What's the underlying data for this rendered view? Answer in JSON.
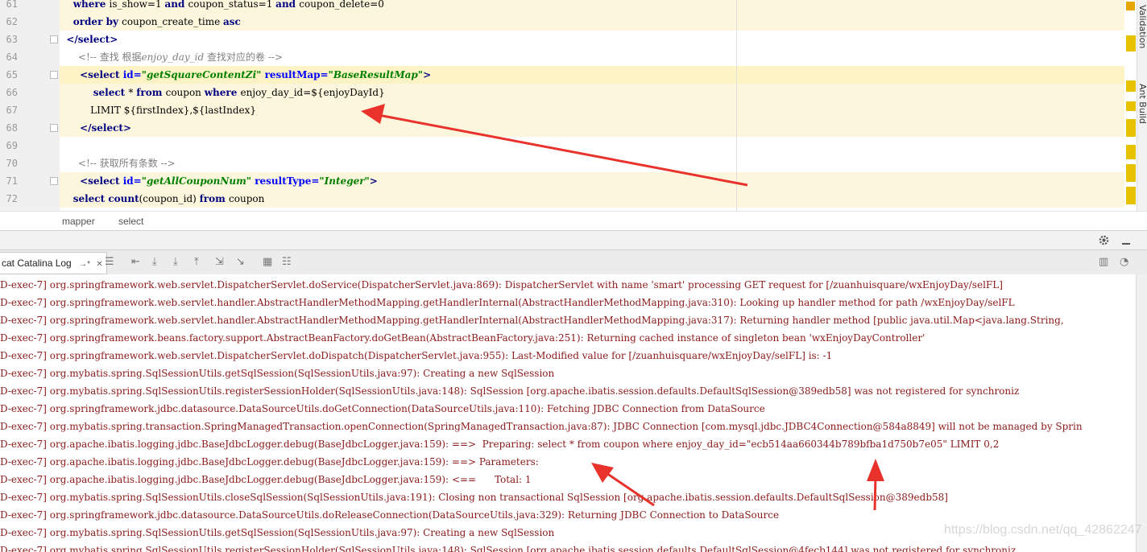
{
  "editor": {
    "lines": [
      {
        "num": "61",
        "parts": [
          [
            "kw",
            "    where "
          ],
          [
            "",
            "is_show=1 "
          ],
          [
            "kw",
            "and "
          ],
          [
            "",
            "coupon_status=1 "
          ],
          [
            "kw",
            "and "
          ],
          [
            "",
            "coupon_delete=0"
          ]
        ]
      },
      {
        "num": "62",
        "parts": [
          [
            "kw",
            "    order by "
          ],
          [
            "",
            "coupon_create_time "
          ],
          [
            "kw",
            "asc"
          ]
        ]
      },
      {
        "num": "63",
        "parts": [
          [
            "tag",
            "  </select>"
          ]
        ]
      },
      {
        "num": "64",
        "parts": [
          [
            "cm",
            "      <!-- 查找 根据"
          ],
          [
            "cmi",
            "enjoy_day_id"
          ],
          [
            "cm",
            " 查找对应的卷 -->"
          ]
        ]
      },
      {
        "num": "65",
        "parts": [
          [
            "tag",
            "      <select "
          ],
          [
            "attr",
            "id="
          ],
          [
            "str",
            "\"getSquareContentZi\" "
          ],
          [
            "attr",
            "resultMap="
          ],
          [
            "str",
            "\"BaseResultMap\""
          ],
          [
            "tag",
            ">"
          ]
        ]
      },
      {
        "num": "66",
        "parts": [
          [
            "kw",
            "          select "
          ],
          [
            "",
            "* "
          ],
          [
            "kw",
            "from "
          ],
          [
            "",
            "coupon "
          ],
          [
            "kw",
            "where "
          ],
          [
            "",
            "enjoy_day_id=${enjoyDayId}"
          ]
        ]
      },
      {
        "num": "67",
        "parts": [
          [
            "",
            "          LIMIT ${firstIndex},${lastIndex}"
          ]
        ]
      },
      {
        "num": "68",
        "parts": [
          [
            "tag",
            "      </select>"
          ]
        ]
      },
      {
        "num": "69",
        "parts": []
      },
      {
        "num": "70",
        "parts": [
          [
            "cm",
            "      <!-- 获取所有条数 -->"
          ]
        ]
      },
      {
        "num": "71",
        "parts": [
          [
            "tag",
            "      <select "
          ],
          [
            "attr",
            "id="
          ],
          [
            "str",
            "\"getAllCouponNum\" "
          ],
          [
            "attr",
            "resultType="
          ],
          [
            "str",
            "\"Integer\""
          ],
          [
            "tag",
            ">"
          ]
        ]
      },
      {
        "num": "72",
        "parts": [
          [
            "kw",
            "    select count"
          ],
          [
            "",
            "(coupon_id) "
          ],
          [
            "kw",
            "from "
          ],
          [
            "",
            "coupon"
          ]
        ]
      }
    ],
    "side_tabs": [
      "Validation",
      "Ant Build"
    ]
  },
  "breadcrumb": [
    "mapper",
    "select"
  ],
  "toolbar": {
    "tab_label": "cat Catalina Log",
    "tab_pin": "→*",
    "tab_close": "✕"
  },
  "console": {
    "lines": [
      "D-exec-7] org.springframework.web.servlet.DispatcherServlet.doService(DispatcherServlet.java:869): DispatcherServlet with name 'smart' processing GET request for [/zuanhuisquare/wxEnjoyDay/selFL]",
      "D-exec-7] org.springframework.web.servlet.handler.AbstractHandlerMethodMapping.getHandlerInternal(AbstractHandlerMethodMapping.java:310): Looking up handler method for path /wxEnjoyDay/selFL",
      "D-exec-7] org.springframework.web.servlet.handler.AbstractHandlerMethodMapping.getHandlerInternal(AbstractHandlerMethodMapping.java:317): Returning handler method [public java.util.Map<java.lang.String,",
      "D-exec-7] org.springframework.beans.factory.support.AbstractBeanFactory.doGetBean(AbstractBeanFactory.java:251): Returning cached instance of singleton bean 'wxEnjoyDayController'",
      "D-exec-7] org.springframework.web.servlet.DispatcherServlet.doDispatch(DispatcherServlet.java:955): Last-Modified value for [/zuanhuisquare/wxEnjoyDay/selFL] is: -1",
      "D-exec-7] org.mybatis.spring.SqlSessionUtils.getSqlSession(SqlSessionUtils.java:97): Creating a new SqlSession",
      "D-exec-7] org.mybatis.spring.SqlSessionUtils.registerSessionHolder(SqlSessionUtils.java:148): SqlSession [org.apache.ibatis.session.defaults.DefaultSqlSession@389edb58] was not registered for synchroniz",
      "D-exec-7] org.springframework.jdbc.datasource.DataSourceUtils.doGetConnection(DataSourceUtils.java:110): Fetching JDBC Connection from DataSource",
      "D-exec-7] org.mybatis.spring.transaction.SpringManagedTransaction.openConnection(SpringManagedTransaction.java:87): JDBC Connection [com.mysql.jdbc.JDBC4Connection@584a8849] will not be managed by Sprin",
      "D-exec-7] org.apache.ibatis.logging.jdbc.BaseJdbcLogger.debug(BaseJdbcLogger.java:159): ==>  Preparing: select * from coupon where enjoy_day_id=\"ecb514aa660344b789bfba1d750b7e05\" LIMIT 0,2",
      "D-exec-7] org.apache.ibatis.logging.jdbc.BaseJdbcLogger.debug(BaseJdbcLogger.java:159): ==> Parameters:",
      "D-exec-7] org.apache.ibatis.logging.jdbc.BaseJdbcLogger.debug(BaseJdbcLogger.java:159): <==      Total: 1",
      "D-exec-7] org.mybatis.spring.SqlSessionUtils.closeSqlSession(SqlSessionUtils.java:191): Closing non transactional SqlSession [org.apache.ibatis.session.defaults.DefaultSqlSession@389edb58]",
      "D-exec-7] org.springframework.jdbc.datasource.DataSourceUtils.doReleaseConnection(DataSourceUtils.java:329): Returning JDBC Connection to DataSource",
      "D-exec-7] org.mybatis.spring.SqlSessionUtils.getSqlSession(SqlSessionUtils.java:97): Creating a new SqlSession",
      "D-exec-7] org.mybatis.spring.SqlSessionUtils.registerSessionHolder(SqlSessionUtils.java:148): SqlSession [org.apache.ibatis.session.defaults.DefaultSqlSession@4fecb144] was not registered for synchroniz"
    ]
  },
  "watermark": "https://blog.csdn.net/qq_42862247",
  "colors": {
    "annotation_arrow": "#e8322b",
    "log_text": "#8b1a1a",
    "highlight": "#fcf6dc"
  },
  "icons": [
    "gear-icon",
    "minimize-icon",
    "soft-wrap-icon",
    "scroll-up-icon",
    "scroll-down-icon",
    "download-icon",
    "upload-icon",
    "filter-icon",
    "clear-icon",
    "print-icon",
    "settings-list-icon",
    "split-icon",
    "tool-icon"
  ]
}
